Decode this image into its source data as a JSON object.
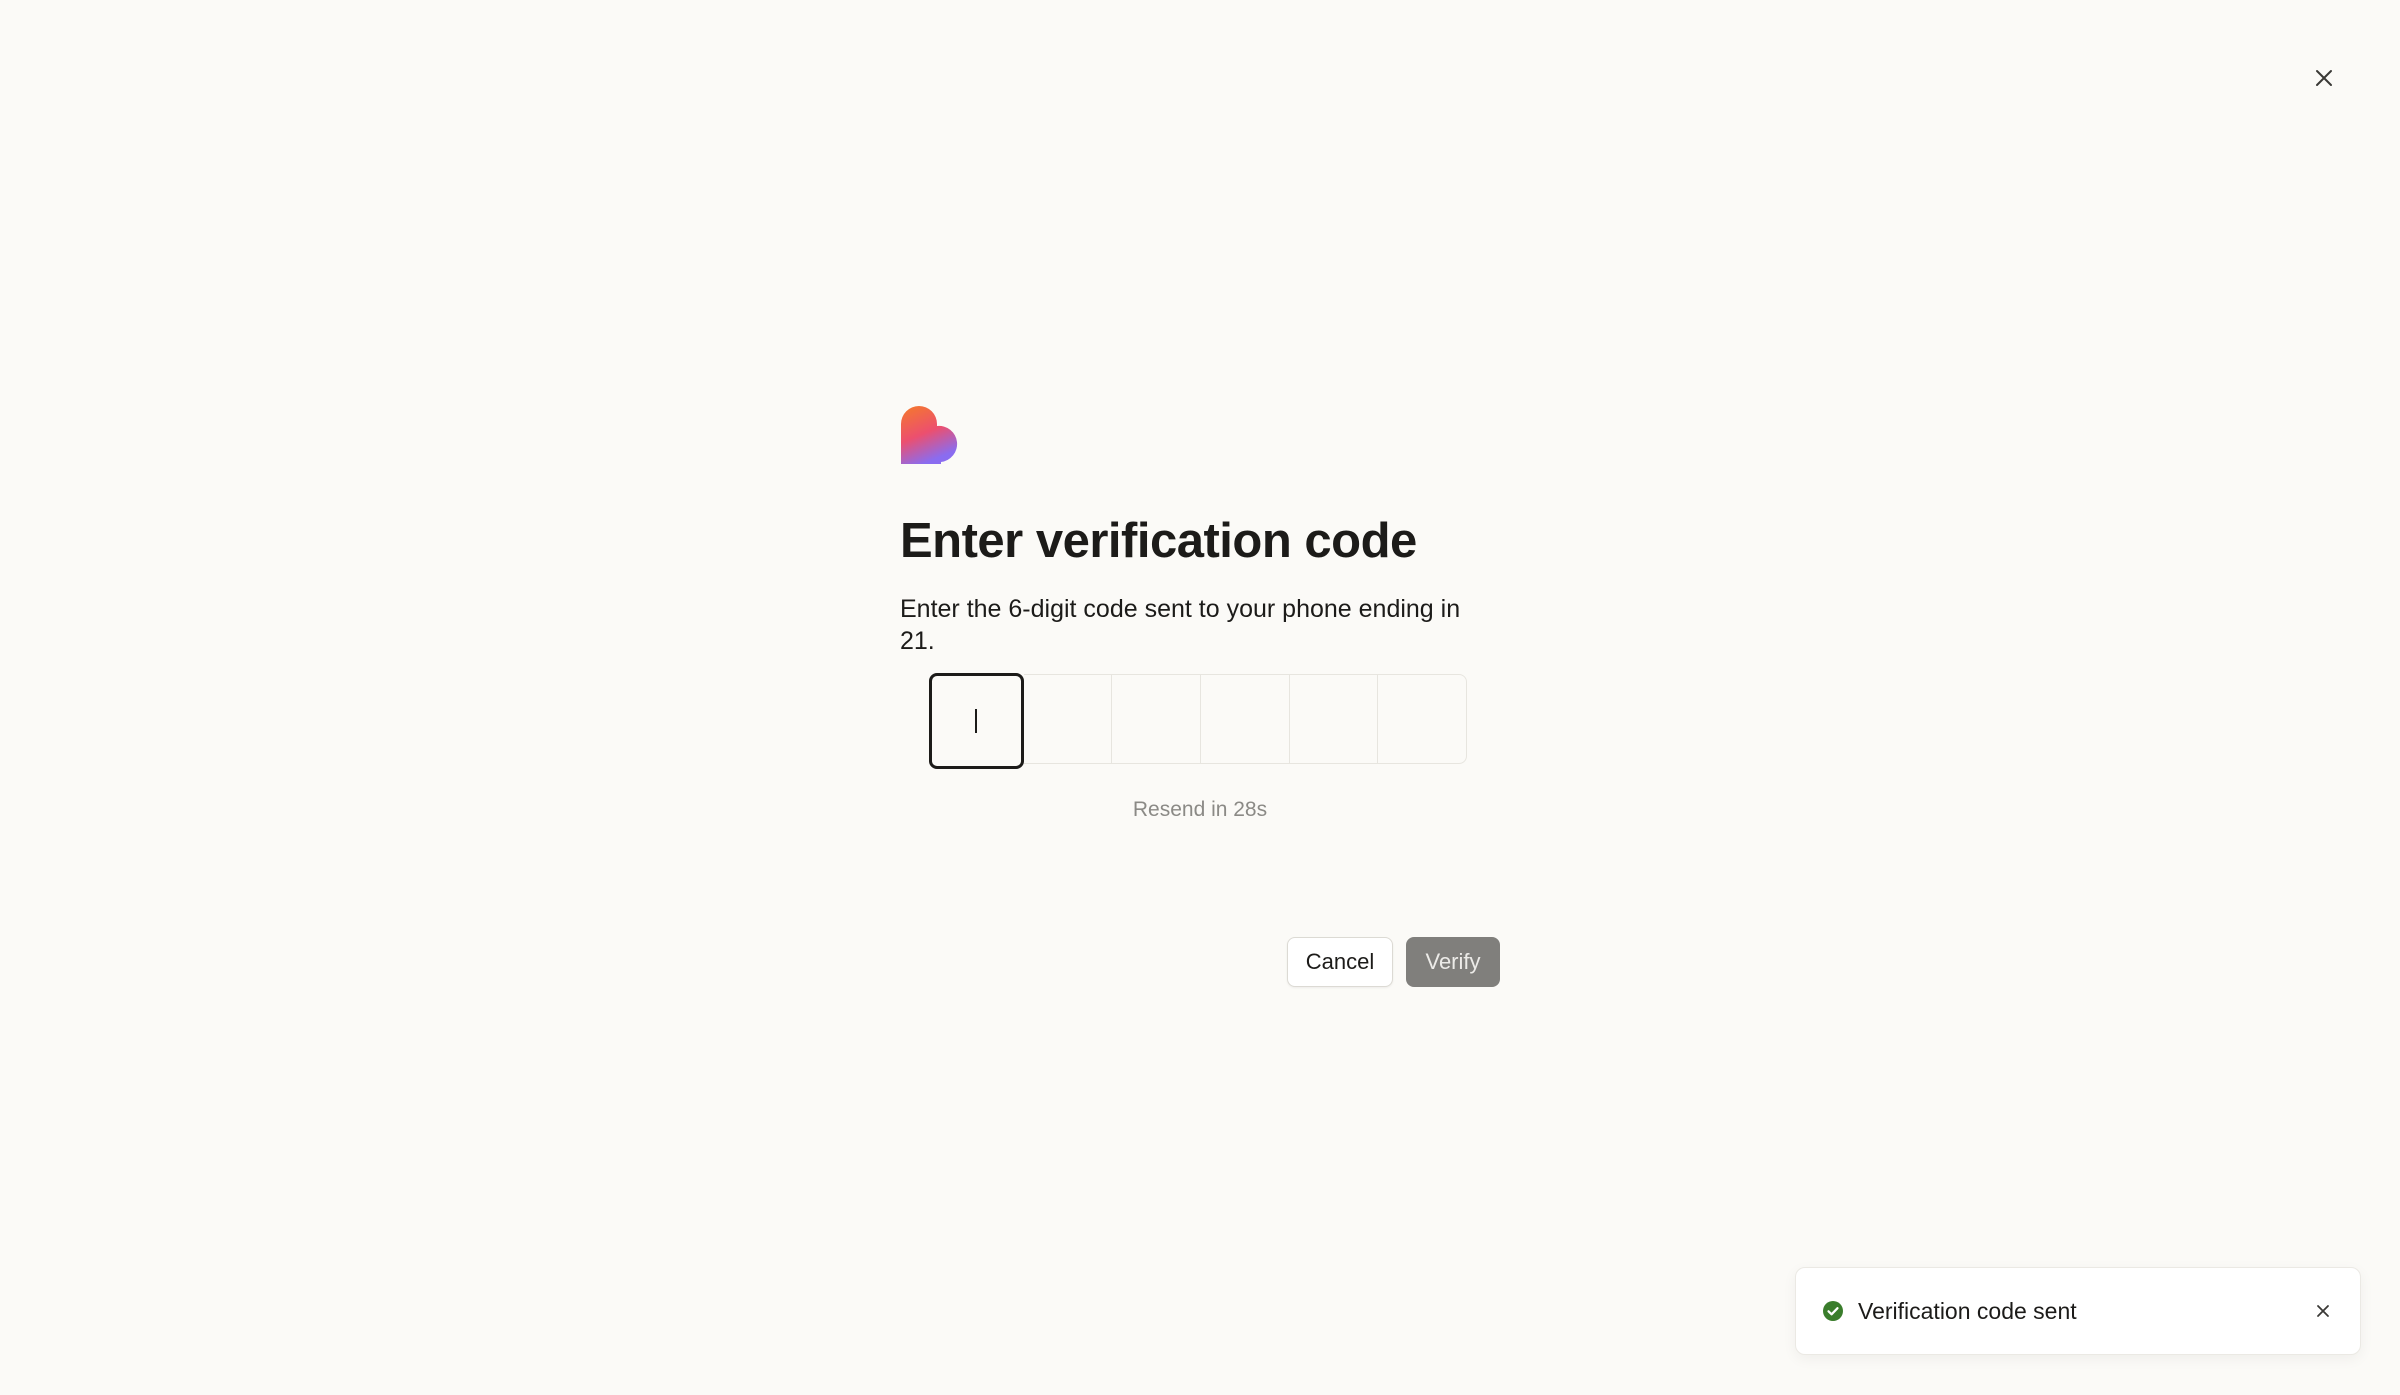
{
  "dialog": {
    "title": "Enter verification code",
    "subtitle": "Enter the 6-digit code sent to your phone ending in 21.",
    "code_digits": [
      "",
      "",
      "",
      "",
      "",
      ""
    ],
    "resend_text": "Resend in 28s",
    "cancel_label": "Cancel",
    "verify_label": "Verify"
  },
  "toast": {
    "message": "Verification code sent",
    "status_color": "#3a7d2c"
  },
  "icons": {
    "close": "close-icon",
    "logo": "heart-logo",
    "toast_status": "check-circle-icon",
    "toast_close": "close-icon"
  }
}
